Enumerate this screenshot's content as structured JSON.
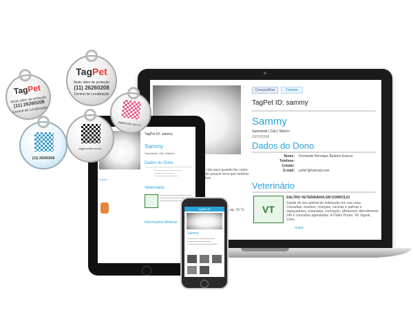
{
  "brand": {
    "name_part1": "Tag",
    "name_part2": "Pet",
    "sub": "CODE.COM"
  },
  "tags": {
    "slogan": "Muito além de proteção",
    "phone": "(11) 26260208",
    "phone_sub": "Central de Localização",
    "url": "tagpetcode.com.br"
  },
  "laptop": {
    "share_label": "Compartilhar",
    "tweet_label": "Tweetar",
    "title": "TagPet ID: sammy",
    "pet_name": "Sammy",
    "pet_desc": "Samoiede | Cão | Macho",
    "pet_date": "20/10/2008",
    "owner_heading": "Dados do Dono",
    "fields": [
      {
        "label": "Nome:",
        "value": "Fernando Henrique Balarini Guerra"
      },
      {
        "label": "Telefone:",
        "value": ""
      },
      {
        "label": "Celular:",
        "value": ""
      },
      {
        "label": "E-mail:",
        "value": "sofia*@hotmail.com"
      }
    ],
    "vet_heading": "Veterinário",
    "vet_name": "DALTRO VETERINÁRIA EM DOMICÍLIO",
    "vet_text": "Saúde de seu animal de estimação em sua casa. Consultas, exames, cirurgias, vacinas e palmas e espaçadores, eutanásia, cremação, Ultrassom. Atendimento 24h e consultas agendadas. A Daltro Puran, Tel Jaguar, Crins.",
    "vet_link": "mapa",
    "left_text": "e não para quando lhe caem vão possuir terra que lembrar Vuro",
    "left_text2": "r, ap. 15 Tu",
    "vet_logo": "VT"
  },
  "tablet": {
    "title": "TagPet ID: sammy",
    "pet_name": "Sammy",
    "pet_desc": "Samoiede | Cão | Macho",
    "owner_heading": "Dados do Dono",
    "vet_heading": "Veterinário",
    "med_heading": "Informações Médicas",
    "left_label": "Saúde"
  },
  "phone": {
    "title": "TagPet ID",
    "pet_name": "Sammy"
  }
}
